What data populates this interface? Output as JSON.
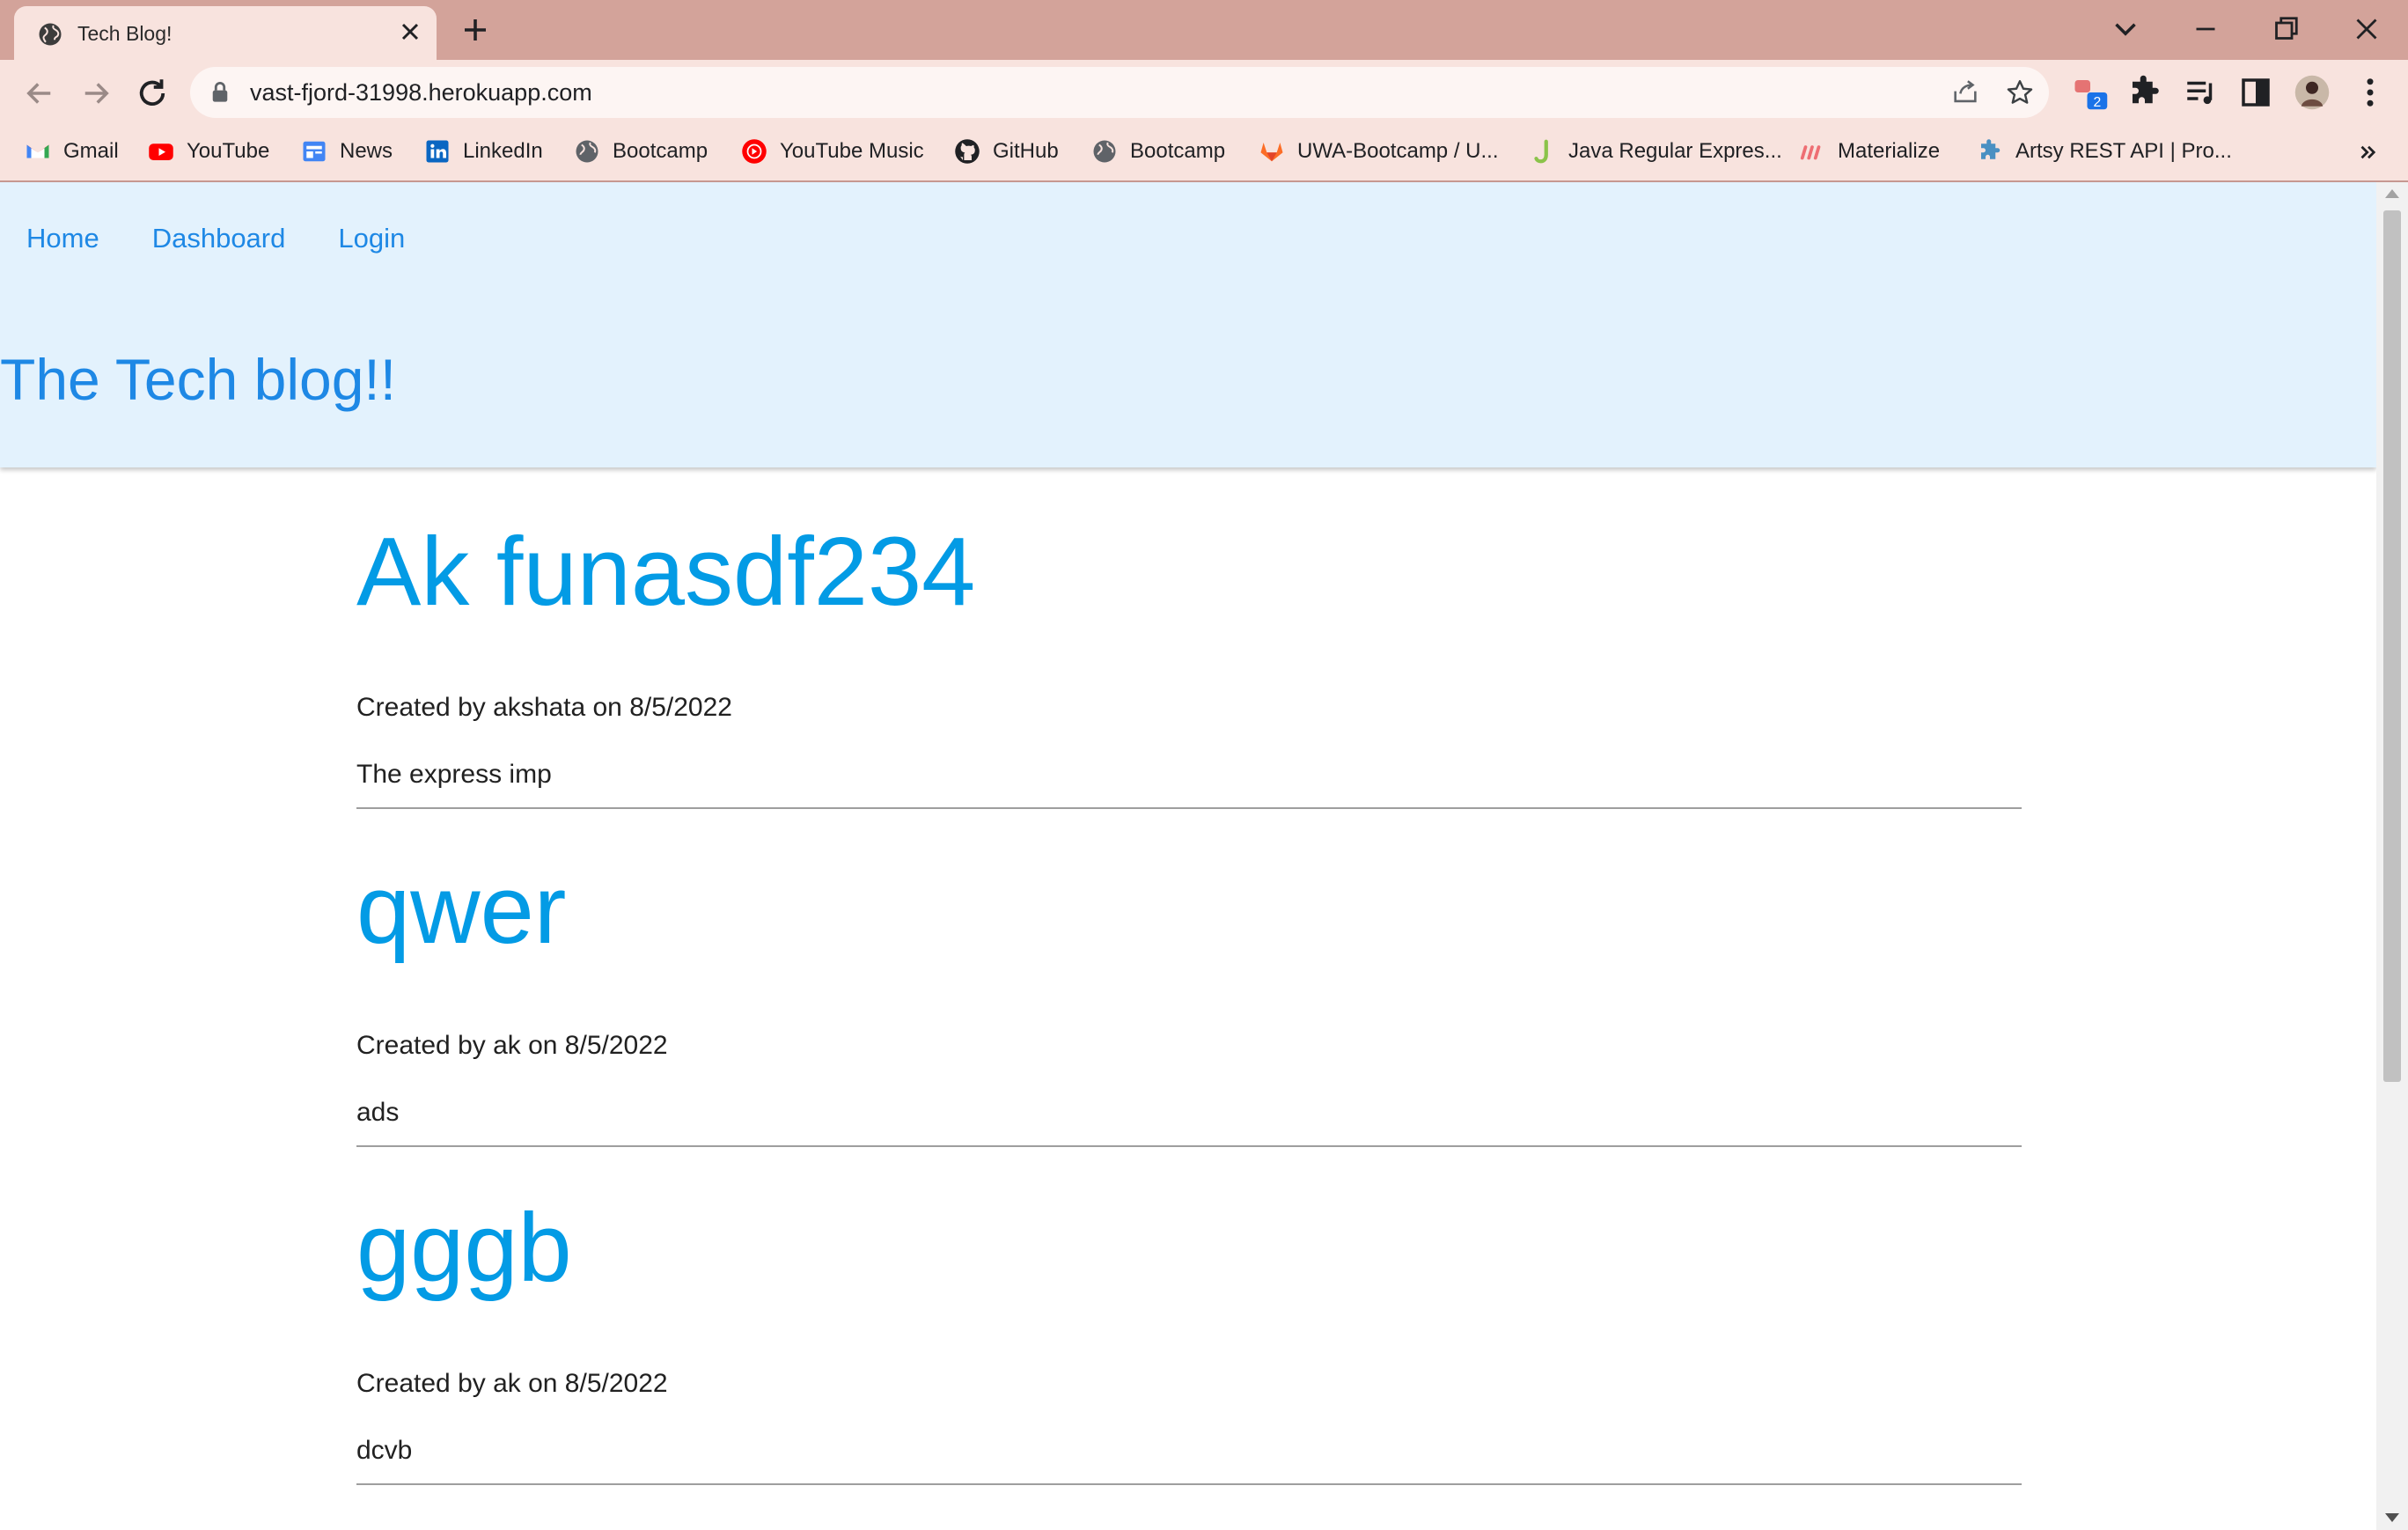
{
  "browser": {
    "tab": {
      "title": "Tech Blog!"
    },
    "url": "vast-fjord-31998.herokuapp.com",
    "extension_badge": "2",
    "bookmarks": [
      {
        "label": "Gmail",
        "icon": "gmail-icon"
      },
      {
        "label": "YouTube",
        "icon": "youtube-icon"
      },
      {
        "label": "News",
        "icon": "news-icon"
      },
      {
        "label": "LinkedIn",
        "icon": "linkedin-icon"
      },
      {
        "label": "Bootcamp",
        "icon": "globe-icon"
      },
      {
        "label": "YouTube Music",
        "icon": "youtube-music-icon"
      },
      {
        "label": "GitHub",
        "icon": "github-icon"
      },
      {
        "label": "Bootcamp",
        "icon": "globe-icon"
      },
      {
        "label": "UWA-Bootcamp / U...",
        "icon": "gitlab-icon"
      },
      {
        "label": "Java Regular Expres...",
        "icon": "j-icon"
      },
      {
        "label": "Materialize",
        "icon": "materialize-icon"
      },
      {
        "label": "Artsy REST API | Pro...",
        "icon": "puzzle-icon"
      }
    ]
  },
  "site": {
    "nav": {
      "home": "Home",
      "dashboard": "Dashboard",
      "login": "Login"
    },
    "title": "The Tech blog!!"
  },
  "posts": [
    {
      "title": "Ak funasdf234",
      "meta": "Created by akshata on 8/5/2022",
      "body": "The express imp"
    },
    {
      "title": "qwer",
      "meta": "Created by ak on 8/5/2022",
      "body": "ads"
    },
    {
      "title": "gggb",
      "meta": "Created by ak on 8/5/2022",
      "body": "dcvb"
    }
  ],
  "colors": {
    "tabstrip": "#d3a39a",
    "toolbar": "#f8e3de",
    "header_bg": "#e3f2fd",
    "accent": "#1e88e5",
    "post_title": "#039be5"
  }
}
